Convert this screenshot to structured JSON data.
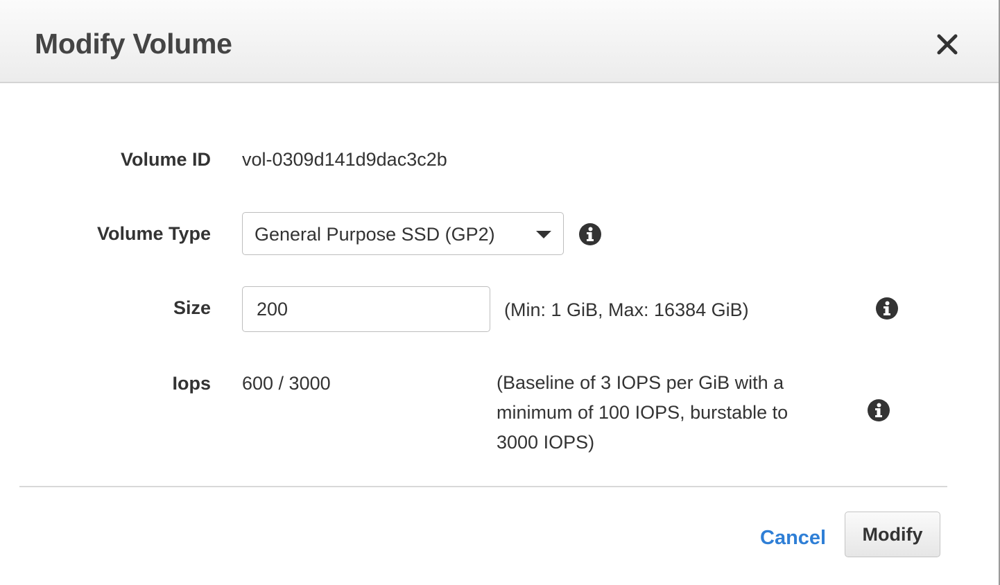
{
  "dialog": {
    "title": "Modify Volume",
    "close_icon": "close-icon"
  },
  "form": {
    "volume_id": {
      "label": "Volume ID",
      "value": "vol-0309d141d9dac3c2b"
    },
    "volume_type": {
      "label": "Volume Type",
      "selected": "General Purpose SSD (GP2)",
      "icon": "info-icon"
    },
    "size": {
      "label": "Size",
      "value": "200",
      "hint": "(Min: 1 GiB, Max: 16384 GiB)",
      "icon": "info-icon"
    },
    "iops": {
      "label": "Iops",
      "value": "600 / 3000",
      "hint_lines": [
        "(Baseline of 3 IOPS per GiB with a",
        "minimum of 100 IOPS, burstable to",
        "3000 IOPS)"
      ],
      "icon": "info-icon"
    }
  },
  "footer": {
    "cancel_label": "Cancel",
    "modify_label": "Modify"
  },
  "colors": {
    "link": "#2f7fd6",
    "text": "#333333",
    "header_bg": "#f2f2f2"
  }
}
